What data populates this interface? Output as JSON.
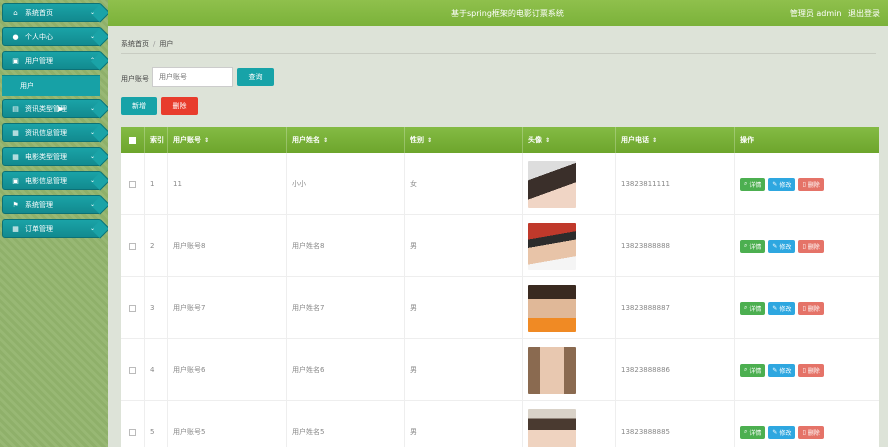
{
  "header": {
    "site_title": "基于spring框架的电影订票系统",
    "user_label": "管理员 admin",
    "logout": "退出登录"
  },
  "sidebar": {
    "items": [
      {
        "label": "系统首页",
        "icon": "home-icon"
      },
      {
        "label": "个人中心",
        "icon": "person-icon"
      },
      {
        "label": "用户管理",
        "icon": "user-manage-icon"
      },
      {
        "label": "资讯类型管理",
        "icon": "database-icon"
      },
      {
        "label": "资讯信息管理",
        "icon": "grid-icon"
      },
      {
        "label": "电影类型管理",
        "icon": "grid-icon"
      },
      {
        "label": "电影信息管理",
        "icon": "film-icon"
      },
      {
        "label": "系统管理",
        "icon": "flag-icon"
      },
      {
        "label": "订单管理",
        "icon": "grid-icon"
      }
    ],
    "sub_item": "用户"
  },
  "breadcrumb": {
    "home": "系统首页",
    "separator": "/",
    "current": "用户"
  },
  "search": {
    "label": "用户账号",
    "placeholder": "用户账号",
    "button": "查询"
  },
  "actions": {
    "add": "新增",
    "delete": "删除"
  },
  "table": {
    "columns": [
      "索引",
      "用户账号",
      "用户姓名",
      "性别",
      "头像",
      "用户电话",
      "操作"
    ],
    "rows": [
      {
        "index": "1",
        "account": "11",
        "name": "小小",
        "gender": "女",
        "phone": "13823811111"
      },
      {
        "index": "2",
        "account": "用户账号8",
        "name": "用户姓名8",
        "gender": "男",
        "phone": "13823888888"
      },
      {
        "index": "3",
        "account": "用户账号7",
        "name": "用户姓名7",
        "gender": "男",
        "phone": "13823888887"
      },
      {
        "index": "4",
        "account": "用户账号6",
        "name": "用户姓名6",
        "gender": "男",
        "phone": "13823888886"
      },
      {
        "index": "5",
        "account": "用户账号5",
        "name": "用户姓名5",
        "gender": "男",
        "phone": "13823888885"
      }
    ],
    "row_actions": {
      "detail": "详情",
      "edit": "修改",
      "delete": "删除"
    }
  },
  "colors": {
    "accent_teal": "#17a3a8",
    "header_green": "#7bb23a",
    "danger_red": "#e83c2c"
  }
}
